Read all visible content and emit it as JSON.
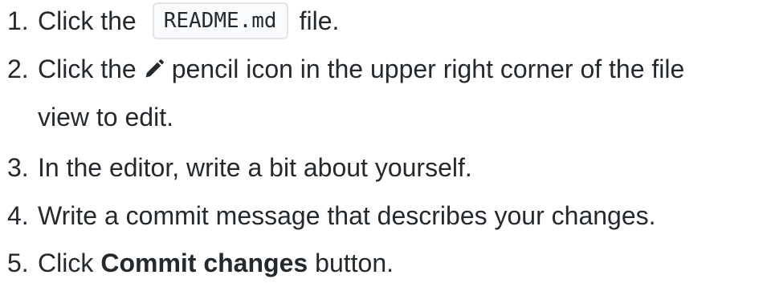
{
  "steps": [
    {
      "number": "1.",
      "before": "Click the",
      "code": "README.md",
      "after": "file."
    },
    {
      "number": "2.",
      "before": "Click the",
      "icon": "pencil-icon",
      "after": "pencil icon in the upper right corner of the file",
      "continuation": "view to edit."
    },
    {
      "number": "3.",
      "text": "In the editor, write a bit about yourself."
    },
    {
      "number": "4.",
      "text": "Write a commit message that describes your changes."
    },
    {
      "number": "5.",
      "before": "Click",
      "bold": "Commit changes",
      "after": "button."
    }
  ]
}
